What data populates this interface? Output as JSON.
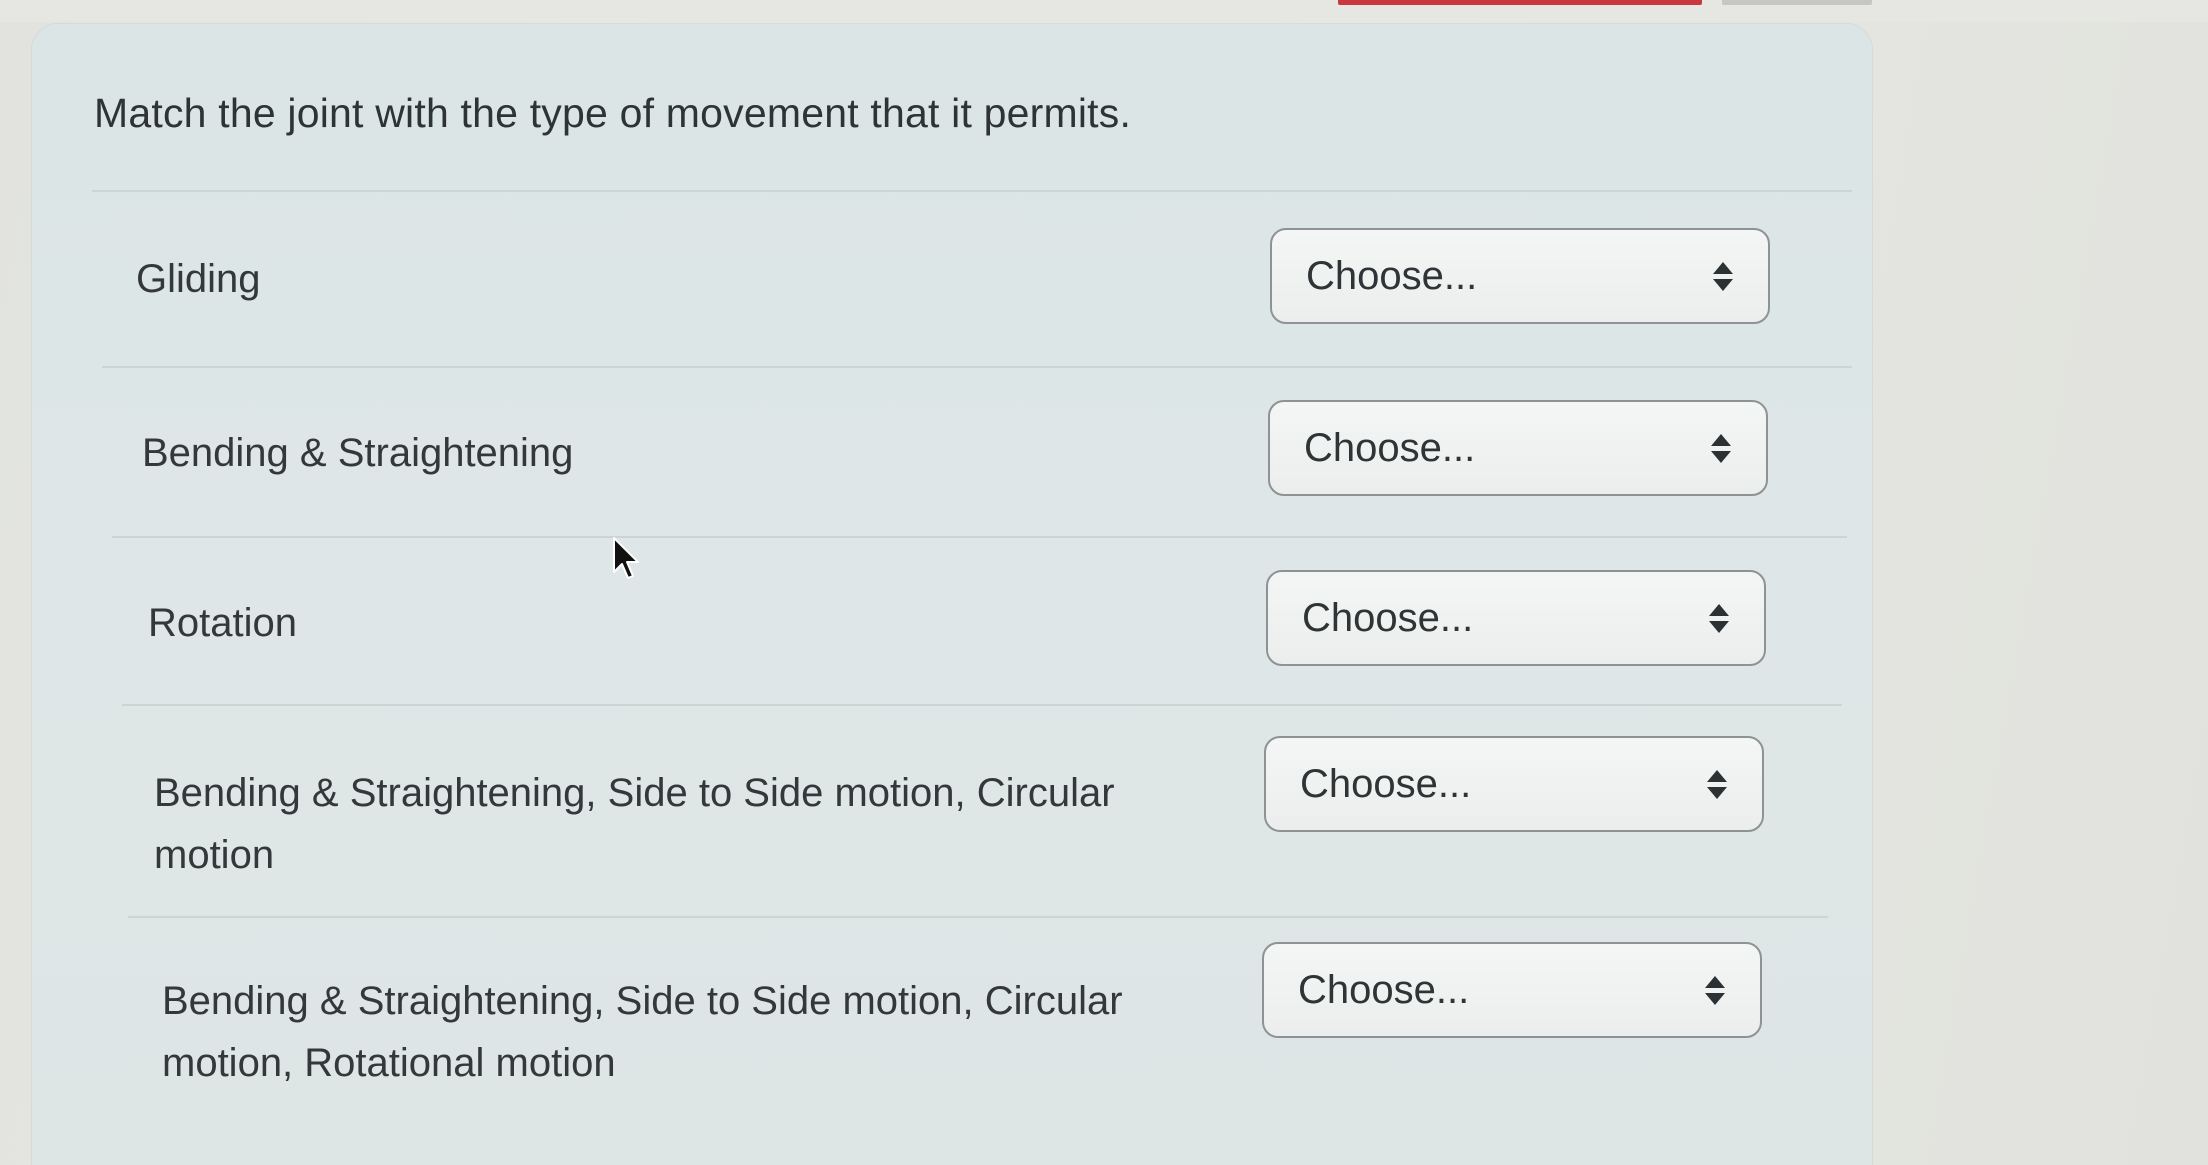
{
  "question": {
    "text": "Match the joint with the type of movement that it permits."
  },
  "rows": [
    {
      "label": "Gliding",
      "select_value": "Choose..."
    },
    {
      "label": "Bending & Straightening",
      "select_value": "Choose..."
    },
    {
      "label": "Rotation",
      "select_value": "Choose..."
    },
    {
      "label": "Bending & Straightening, Side to Side motion, Circular motion",
      "select_value": "Choose..."
    },
    {
      "label": "Bending & Straightening, Side to Side motion, Circular motion, Rotational motion",
      "select_value": "Choose..."
    }
  ],
  "icons": {
    "select_arrows": "up-down-arrows-icon",
    "cursor": "mouse-pointer-icon"
  },
  "colors": {
    "panel_background": "#dde5e5",
    "select_border": "#8d9394",
    "text": "#33383a",
    "top_accent": "#c9383f"
  }
}
